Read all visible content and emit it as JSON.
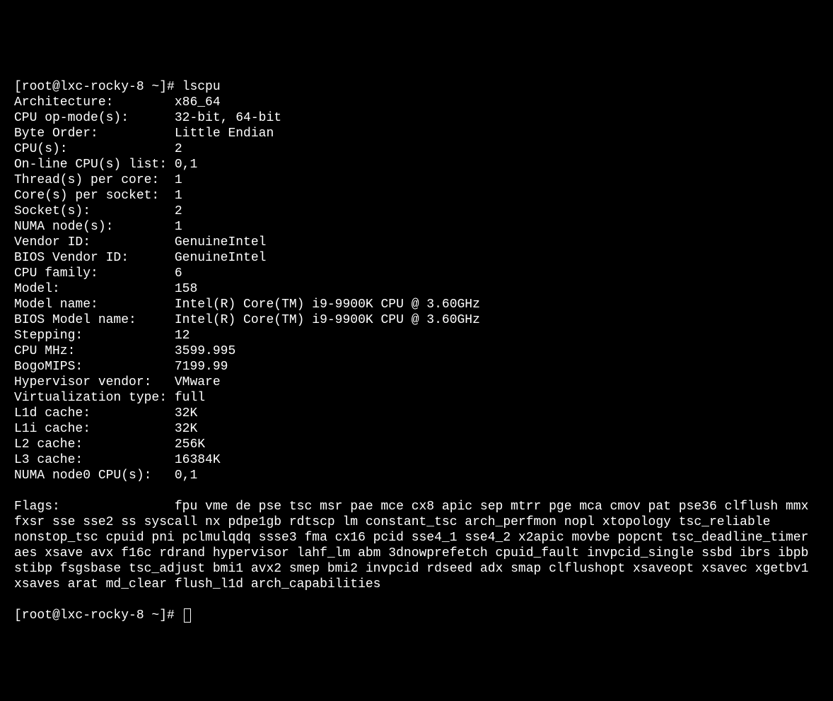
{
  "prompt1": "[root@lxc-rocky-8 ~]# ",
  "command": "lscpu",
  "prompt2": "[root@lxc-rocky-8 ~]# ",
  "fields": [
    {
      "label": "Architecture:",
      "value": "x86_64"
    },
    {
      "label": "CPU op-mode(s):",
      "value": "32-bit, 64-bit"
    },
    {
      "label": "Byte Order:",
      "value": "Little Endian"
    },
    {
      "label": "CPU(s):",
      "value": "2"
    },
    {
      "label": "On-line CPU(s) list:",
      "value": "0,1"
    },
    {
      "label": "Thread(s) per core:",
      "value": "1"
    },
    {
      "label": "Core(s) per socket:",
      "value": "1"
    },
    {
      "label": "Socket(s):",
      "value": "2"
    },
    {
      "label": "NUMA node(s):",
      "value": "1"
    },
    {
      "label": "Vendor ID:",
      "value": "GenuineIntel"
    },
    {
      "label": "BIOS Vendor ID:",
      "value": "GenuineIntel"
    },
    {
      "label": "CPU family:",
      "value": "6"
    },
    {
      "label": "Model:",
      "value": "158"
    },
    {
      "label": "Model name:",
      "value": "Intel(R) Core(TM) i9-9900K CPU @ 3.60GHz"
    },
    {
      "label": "BIOS Model name:",
      "value": "Intel(R) Core(TM) i9-9900K CPU @ 3.60GHz"
    },
    {
      "label": "Stepping:",
      "value": "12"
    },
    {
      "label": "CPU MHz:",
      "value": "3599.995"
    },
    {
      "label": "BogoMIPS:",
      "value": "7199.99"
    },
    {
      "label": "Hypervisor vendor:",
      "value": "VMware"
    },
    {
      "label": "Virtualization type:",
      "value": "full"
    },
    {
      "label": "L1d cache:",
      "value": "32K"
    },
    {
      "label": "L1i cache:",
      "value": "32K"
    },
    {
      "label": "L2 cache:",
      "value": "256K"
    },
    {
      "label": "L3 cache:",
      "value": "16384K"
    },
    {
      "label": "NUMA node0 CPU(s):",
      "value": "0,1"
    }
  ],
  "flags_label": "Flags:",
  "flags_value": "fpu vme de pse tsc msr pae mce cx8 apic sep mtrr pge mca cmov pat pse36 clflush mmx fxsr sse sse2 ss syscall nx pdpe1gb rdtscp lm constant_tsc arch_perfmon nopl xtopology tsc_reliable nonstop_tsc cpuid pni pclmulqdq ssse3 fma cx16 pcid sse4_1 sse4_2 x2apic movbe popcnt tsc_deadline_timer aes xsave avx f16c rdrand hypervisor lahf_lm abm 3dnowprefetch cpuid_fault invpcid_single ssbd ibrs ibpb stibp fsgsbase tsc_adjust bmi1 avx2 smep bmi2 invpcid rdseed adx smap clflushopt xsaveopt xsavec xgetbv1 xsaves arat md_clear flush_l1d arch_capabilities"
}
